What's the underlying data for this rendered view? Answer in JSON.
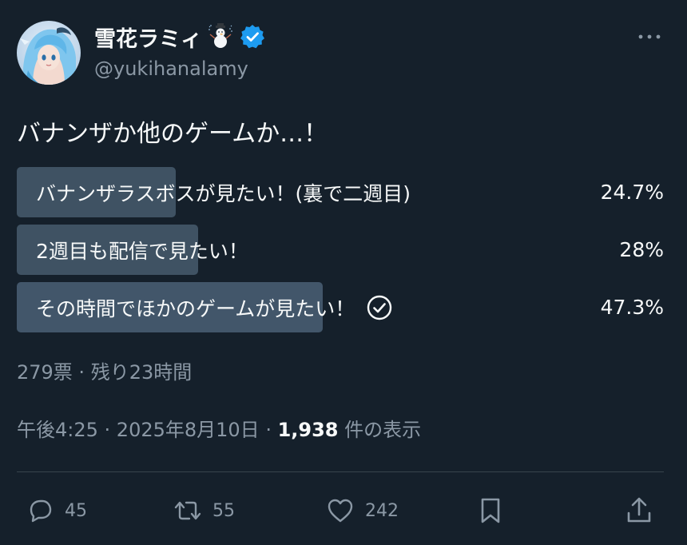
{
  "author": {
    "display_name": "雪花ラミィ",
    "handle": "@yukihanalamy",
    "name_emoji": "snowman-icon",
    "verified_color": "#1d9bf0"
  },
  "tweet": {
    "text": "バナンザか他のゲームか…！"
  },
  "poll": {
    "options": [
      {
        "label": "バナンザラスボスが見たい！(裏で二週目)",
        "percent_text": "24.7%",
        "percent": 24.7,
        "selected": false
      },
      {
        "label": "2週目も配信で見たい！",
        "percent_text": "28%",
        "percent": 28,
        "selected": false
      },
      {
        "label": "その時間でほかのゲームが見たい！",
        "percent_text": "47.3%",
        "percent": 47.3,
        "selected": true
      }
    ],
    "meta": "279票 · 残り23時間"
  },
  "timestamp": {
    "time": "午後4:25",
    "separator": " · ",
    "date": "2025年8月10日",
    "views_count": "1,938",
    "views_label": " 件の表示"
  },
  "actions": {
    "reply_count": "45",
    "retweet_count": "55",
    "like_count": "242"
  },
  "colors": {
    "background": "#15202b",
    "bar": "#3f5263",
    "muted_text": "#8b98a5",
    "accent": "#1d9bf0"
  }
}
